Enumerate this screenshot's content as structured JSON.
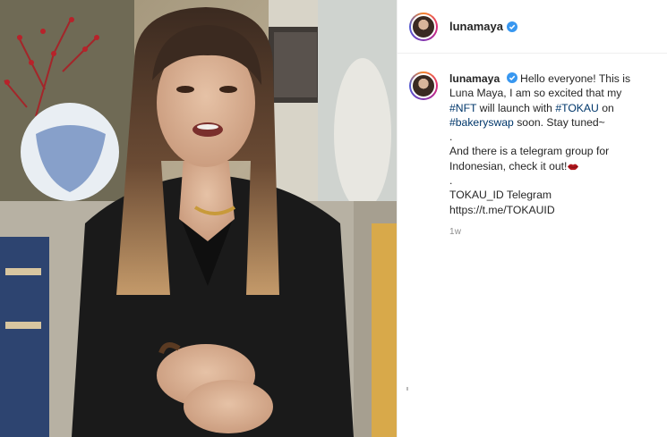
{
  "header": {
    "username": "lunamaya"
  },
  "post": {
    "username": "lunamaya",
    "caption_line1": "Hello everyone! This is",
    "caption_line2": "Luna Maya, I am so excited that my",
    "tag_nft": "#NFT",
    "text_will_launch": " will launch with ",
    "tag_tokau": "#TOKAU",
    "text_on": " on",
    "tag_bakeryswap": "#bakeryswap",
    "text_soon": " soon. Stay tuned~",
    "dot1": ".",
    "caption_line5": "And there is a telegram group for",
    "caption_line6": "Indonesian, check it out!",
    "dot2": ".",
    "caption_line7": "TOKAU_ID Telegram",
    "caption_line8": "https://t.me/TOKAUID",
    "timestamp": "1w"
  },
  "icons": {
    "verified": "verified-badge-icon",
    "lips": "kiss-mark-icon"
  },
  "colors": {
    "verified_blue": "#3897f0",
    "hashtag": "#00376b",
    "muted": "#8e8e8e"
  }
}
